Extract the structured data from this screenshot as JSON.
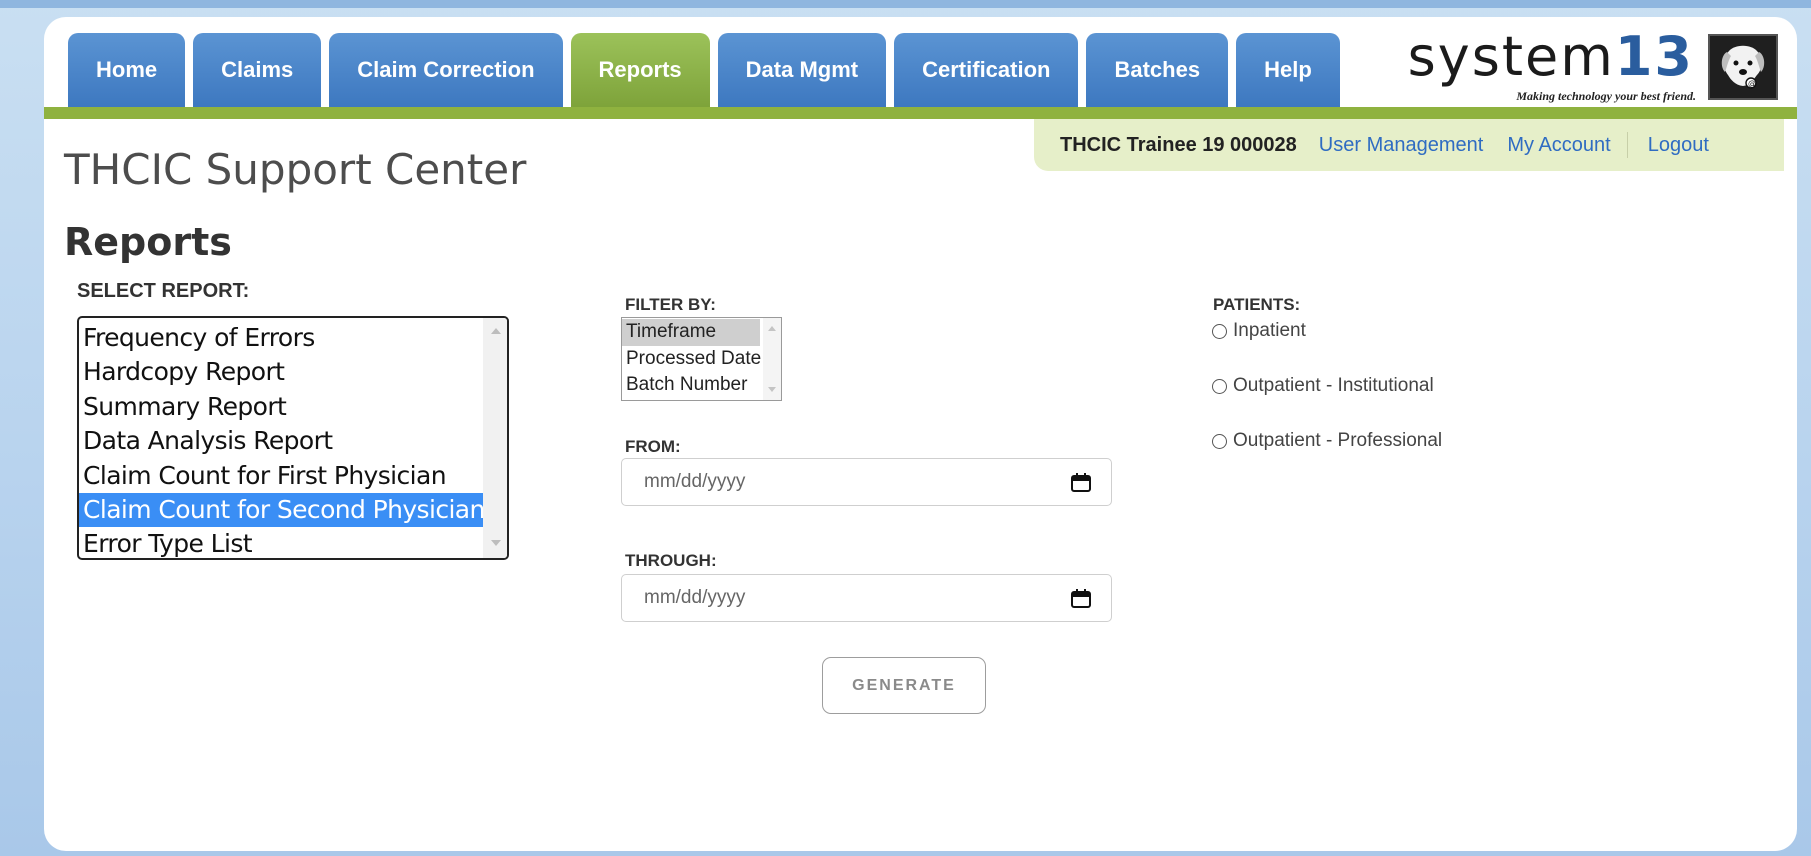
{
  "nav": {
    "tabs": [
      {
        "label": "Home"
      },
      {
        "label": "Claims"
      },
      {
        "label": "Claim Correction"
      },
      {
        "label": "Reports"
      },
      {
        "label": "Data Mgmt"
      },
      {
        "label": "Certification"
      },
      {
        "label": "Batches"
      },
      {
        "label": "Help"
      }
    ],
    "active_tab": "Reports"
  },
  "logo": {
    "text": "system",
    "number": "13",
    "tagline": "Making technology your best friend."
  },
  "user_bar": {
    "user": "THCIC Trainee 19 000028",
    "user_management": "User Management",
    "my_account": "My Account",
    "logout": "Logout"
  },
  "site_title": "THCIC Support Center",
  "page_heading": "Reports",
  "select_report": {
    "label": "SELECT REPORT:",
    "items": [
      "Frequency of Errors",
      "Hardcopy Report",
      "Summary Report",
      "Data Analysis Report",
      "Claim Count for First Physician",
      "Claim Count for Second Physician",
      "Error Type List"
    ],
    "selected": "Claim Count for Second Physician"
  },
  "filter": {
    "label": "FILTER BY:",
    "options": [
      "Timeframe",
      "Processed Date",
      "Batch Number"
    ],
    "selected": "Timeframe"
  },
  "from": {
    "label": "FROM:",
    "placeholder": "mm/dd/yyyy"
  },
  "through": {
    "label": "THROUGH:",
    "placeholder": "mm/dd/yyyy"
  },
  "patients": {
    "label": "PATIENTS:",
    "options": [
      "Inpatient",
      "Outpatient - Institutional",
      "Outpatient - Professional"
    ]
  },
  "generate_label": "GENERATE",
  "colors": {
    "tab_blue": "#3d78c0",
    "tab_active_green": "#7ea33a",
    "accent_bar": "#8fb23f",
    "selection_blue": "#3a8ef5",
    "link_blue": "#2f6cc2"
  }
}
